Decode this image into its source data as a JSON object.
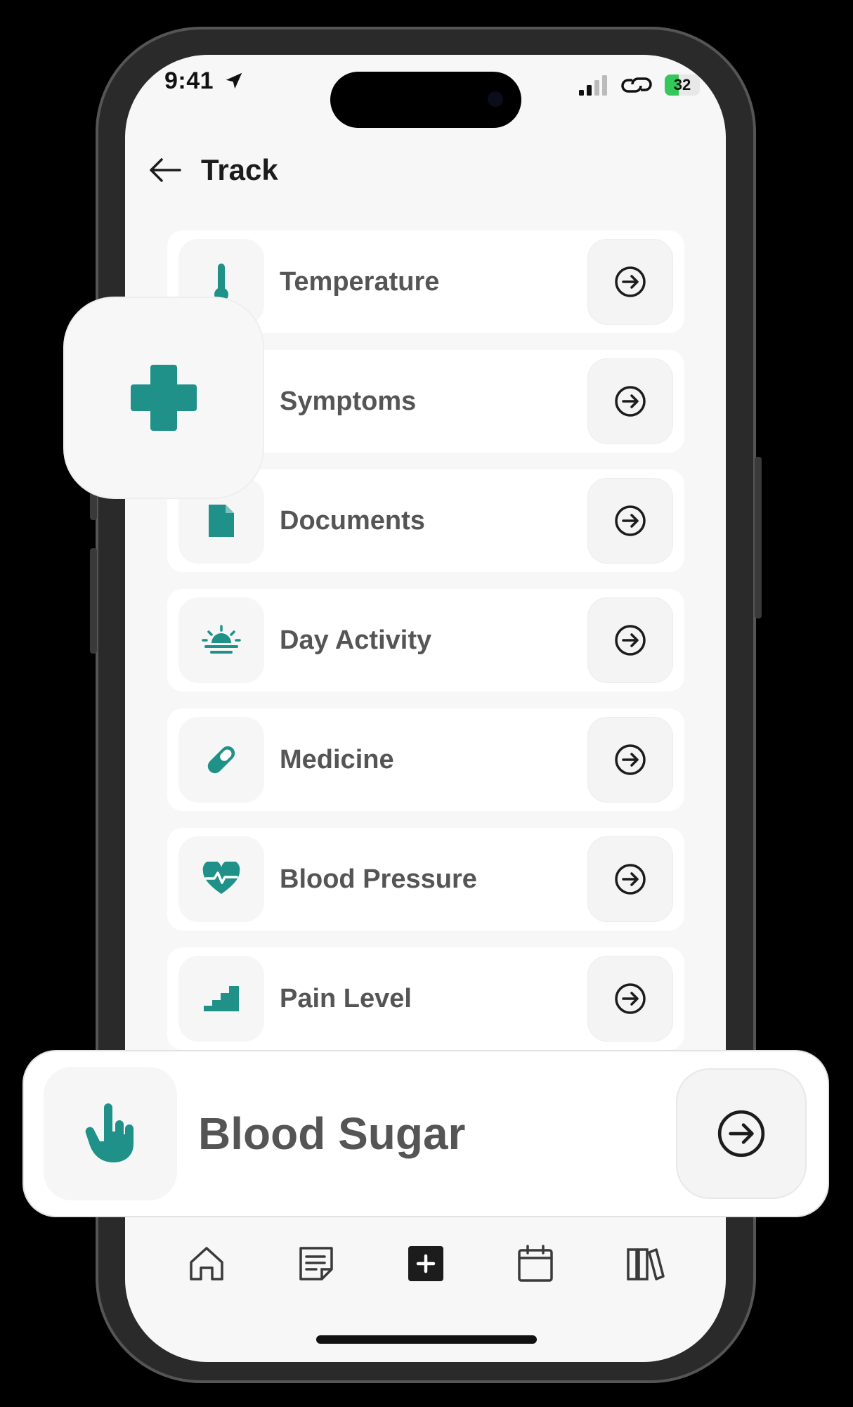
{
  "status_bar": {
    "time": "9:41",
    "battery": "32"
  },
  "header": {
    "title": "Track"
  },
  "items": [
    {
      "label": "Temperature",
      "icon": "thermometer-icon"
    },
    {
      "label": "Symptoms",
      "icon": "medical-cross-icon"
    },
    {
      "label": "Documents",
      "icon": "document-icon"
    },
    {
      "label": "Day Activity",
      "icon": "sunrise-icon"
    },
    {
      "label": "Medicine",
      "icon": "pill-icon"
    },
    {
      "label": "Blood Pressure",
      "icon": "heart-pulse-icon"
    },
    {
      "label": "Pain Level",
      "icon": "stairs-icon"
    }
  ],
  "highlight": {
    "label": "Blood Sugar",
    "icon": "hand-pointer-icon"
  },
  "tabbar": [
    "home-icon",
    "notes-icon",
    "add-icon",
    "calendar-icon",
    "library-icon"
  ],
  "colors": {
    "accent": "#1f9189",
    "text": "#555555",
    "background": "#f7f7f7"
  }
}
